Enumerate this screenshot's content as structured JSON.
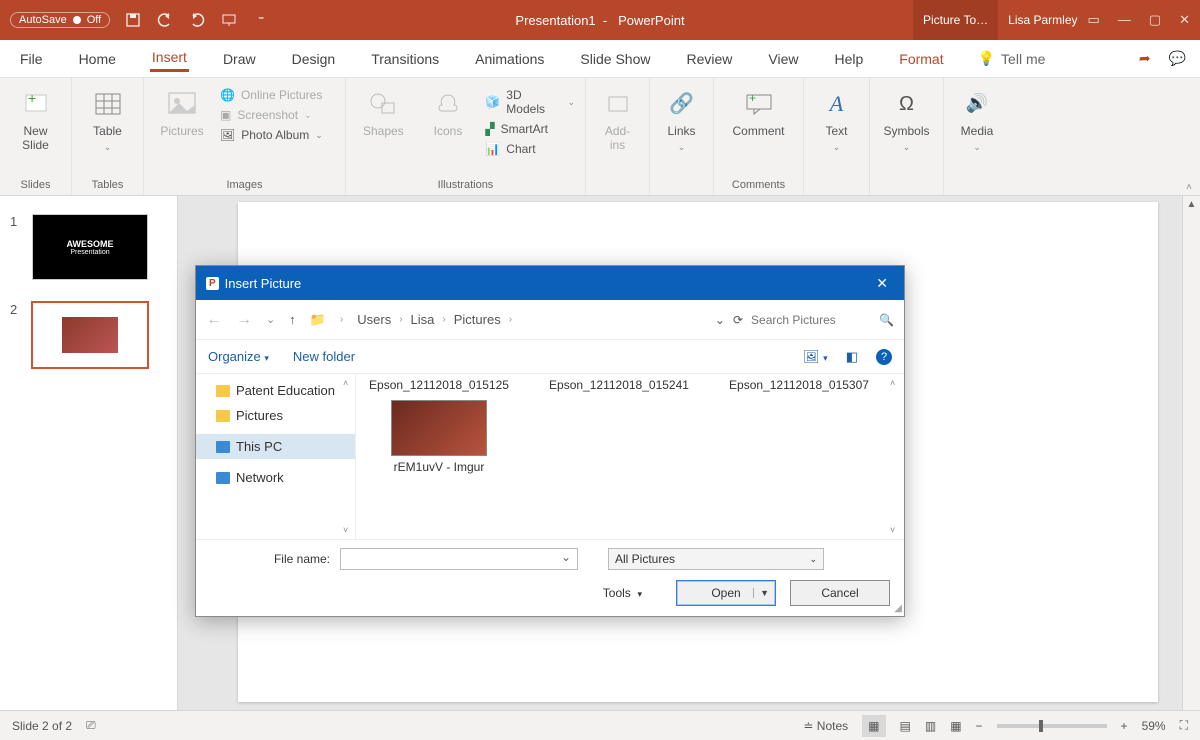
{
  "titlebar": {
    "autosave_label": "AutoSave",
    "autosave_state": "Off",
    "doc_title": "Presentation1",
    "app_name": "PowerPoint",
    "contextual_tab": "Picture To…",
    "user_name": "Lisa Parmley"
  },
  "tabs": {
    "file": "File",
    "home": "Home",
    "insert": "Insert",
    "draw": "Draw",
    "design": "Design",
    "transitions": "Transitions",
    "animations": "Animations",
    "slideshow": "Slide Show",
    "review": "Review",
    "view": "View",
    "help": "Help",
    "format": "Format",
    "tellme": "Tell me"
  },
  "ribbon": {
    "slides": {
      "new_slide": "New\nSlide",
      "group": "Slides"
    },
    "tables": {
      "table": "Table",
      "group": "Tables"
    },
    "images": {
      "pictures": "Pictures",
      "online": "Online Pictures",
      "screenshot": "Screenshot",
      "album": "Photo Album",
      "group": "Images"
    },
    "illus": {
      "shapes": "Shapes",
      "icons": "Icons",
      "models": "3D Models",
      "smartart": "SmartArt",
      "chart": "Chart",
      "group": "Illustrations"
    },
    "addins": {
      "label": "Add-\nins"
    },
    "links": {
      "label": "Links"
    },
    "comments": {
      "comment": "Comment",
      "group": "Comments"
    },
    "text": {
      "label": "Text"
    },
    "symbols": {
      "label": "Symbols"
    },
    "media": {
      "label": "Media"
    }
  },
  "slides": {
    "thumb1_line1": "AWESOME",
    "thumb1_line2": "Presentation",
    "n1": "1",
    "n2": "2"
  },
  "dialog": {
    "title": "Insert Picture",
    "crumbs": [
      "Users",
      "Lisa",
      "Pictures"
    ],
    "search_placeholder": "Search Pictures",
    "organize": "Organize",
    "new_folder": "New folder",
    "tree": {
      "patent": "Patent Education",
      "pictures": "Pictures",
      "thispc": "This PC",
      "network": "Network"
    },
    "files": {
      "f1": "Epson_12112018_015125",
      "f2": "Epson_12112018_015241",
      "f3": "Epson_12112018_015307",
      "f4": "rEM1uvV - Imgur"
    },
    "filename_label": "File name:",
    "filter": "All Pictures",
    "tools": "Tools",
    "open": "Open",
    "cancel": "Cancel"
  },
  "status": {
    "slide_info": "Slide 2 of 2",
    "notes": "Notes",
    "zoom": "59%"
  }
}
